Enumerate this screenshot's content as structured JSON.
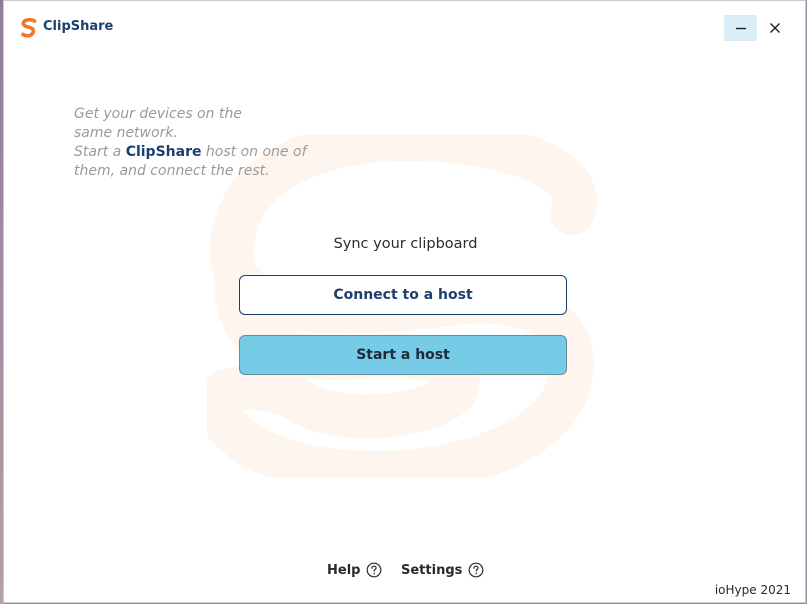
{
  "window": {
    "title": "ClipShare",
    "minimize_icon": "minimize-icon",
    "close_icon": "close-icon"
  },
  "intro": {
    "line1": "Get your devices on the",
    "line2": "same network.",
    "line3_prefix": "Start a ",
    "line3_brand": "ClipShare",
    "line3_suffix": " host on one of",
    "line4": "them, and connect the rest."
  },
  "main": {
    "heading": "Sync your clipboard",
    "connect_label": "Connect to a host",
    "start_label": "Start a host"
  },
  "footer": {
    "help_label": "Help",
    "settings_label": "Settings",
    "help_icon": "question-circle-icon",
    "copyright": "ioHype 2021"
  },
  "colors": {
    "brand_navy": "#1d3f6e",
    "accent_orange": "#f0782a",
    "primary_button": "#76cbe6",
    "watermark": "#fef6ee"
  }
}
